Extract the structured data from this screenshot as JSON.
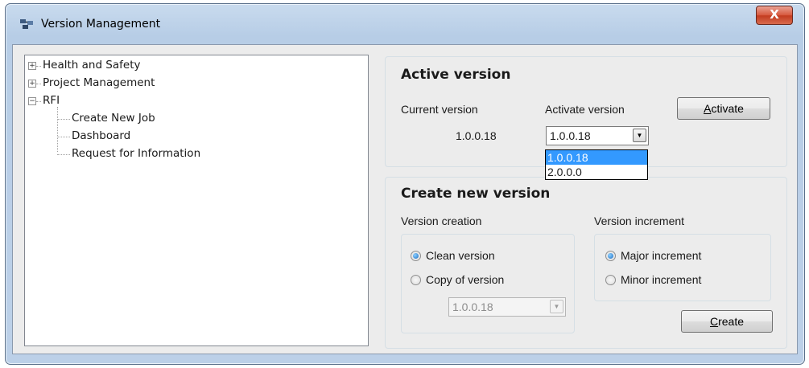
{
  "window": {
    "title": "Version Management",
    "close_glyph": "X",
    "app_icon": "version-management-icon"
  },
  "tree": {
    "nodes": [
      {
        "label": "Health and Safety",
        "expander": "+"
      },
      {
        "label": "Project Management",
        "expander": "+"
      },
      {
        "label": "RFI",
        "expander": "−",
        "children": [
          "Create New Job",
          "Dashboard",
          "Request for Information"
        ]
      }
    ]
  },
  "active_version": {
    "title": "Active version",
    "current_label": "Current version",
    "current_value": "1.0.0.18",
    "activate_label": "Activate version",
    "activate_selected": "1.0.0.18",
    "dropdown_options": [
      "1.0.0.18",
      "2.0.0.0"
    ],
    "dropdown_highlighted": "1.0.0.18",
    "activate_button_first": "A",
    "activate_button_rest": "ctivate"
  },
  "create_version": {
    "title": "Create new version",
    "creation_label": "Version creation",
    "increment_label": "Version increment",
    "clean_option": "Clean version",
    "copy_option": "Copy of version",
    "copy_selected": "1.0.0.18",
    "major_option": "Major increment",
    "minor_option": "Minor increment",
    "creation_checked": "Clean version",
    "increment_checked": "Major increment",
    "create_button_first": "C",
    "create_button_rest": "reate"
  }
}
